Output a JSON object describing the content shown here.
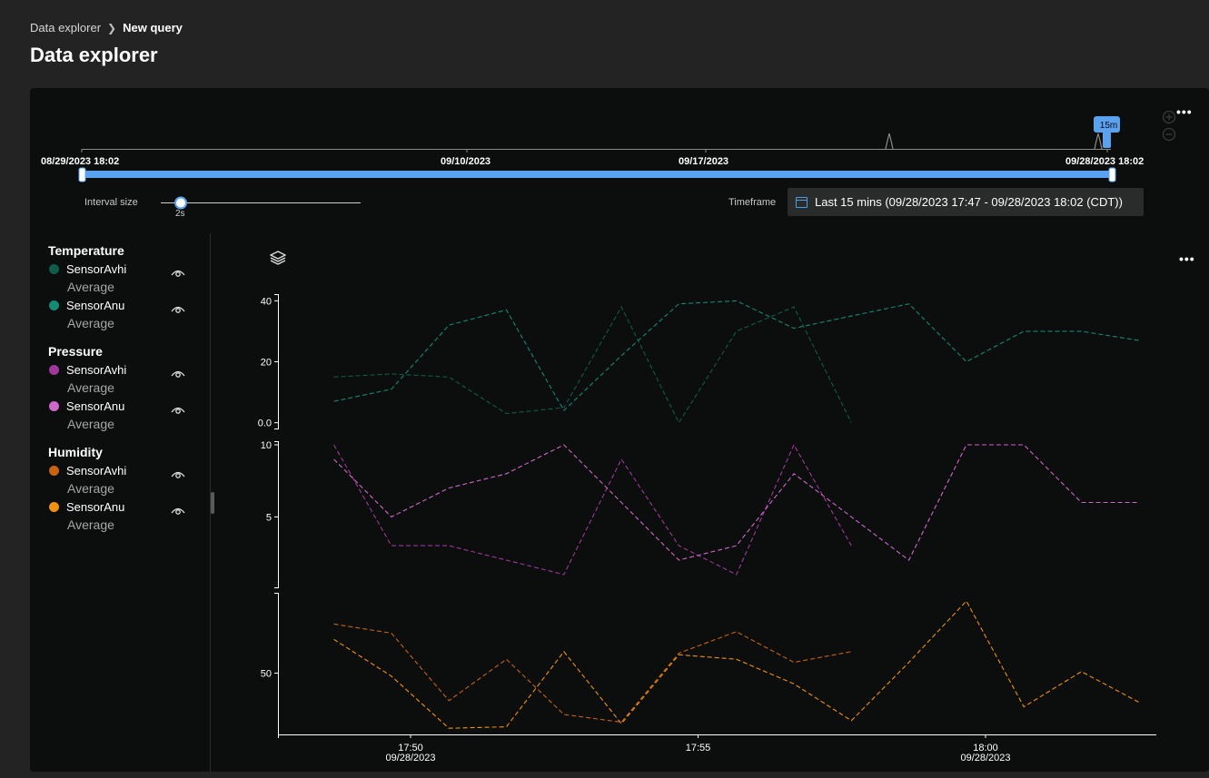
{
  "breadcrumb": {
    "parent": "Data explorer",
    "current": "New query"
  },
  "page_title": "Data explorer",
  "timeline": {
    "dates": [
      "08/29/2023 18:02",
      "09/10/2023",
      "09/17/2023",
      "09/28/2023 18:02"
    ],
    "window_badge": "15m"
  },
  "interval": {
    "label": "Interval size",
    "value": "2s"
  },
  "timeframe": {
    "label": "Timeframe",
    "value": "Last 15 mins (09/28/2023 17:47 - 09/28/2023 18:02 (CDT))"
  },
  "legend": [
    {
      "group": "Temperature",
      "items": [
        {
          "name": "SensorAvhi",
          "agg": "Average",
          "color": "#0e5c4a"
        },
        {
          "name": "SensorAnu",
          "agg": "Average",
          "color": "#128a74"
        }
      ]
    },
    {
      "group": "Pressure",
      "items": [
        {
          "name": "SensorAvhi",
          "agg": "Average",
          "color": "#a1379c"
        },
        {
          "name": "SensorAnu",
          "agg": "Average",
          "color": "#d067cc"
        }
      ]
    },
    {
      "group": "Humidity",
      "items": [
        {
          "name": "SensorAvhi",
          "agg": "Average",
          "color": "#c9630f"
        },
        {
          "name": "SensorAnu",
          "agg": "Average",
          "color": "#f0910f"
        }
      ]
    }
  ],
  "chart_data": {
    "type": "line",
    "x_ticks": [
      {
        "time": "17:50",
        "date": "09/28/2023"
      },
      {
        "time": "17:55",
        "date": ""
      },
      {
        "time": "18:00",
        "date": "09/28/2023"
      }
    ],
    "panels": [
      {
        "name": "Temperature",
        "y_ticks": [
          "40",
          "20",
          "0.0"
        ],
        "ylim": [
          -1,
          41
        ],
        "series": [
          {
            "name": "SensorAvhi",
            "color": "#0e5c4a",
            "x": [
              "17:48:40",
              "17:49:40",
              "17:50:40",
              "17:51:40",
              "17:52:40",
              "17:53:40",
              "17:54:40",
              "17:55:40",
              "17:56:40",
              "17:57:40"
            ],
            "values": [
              15,
              16,
              15,
              3,
              5,
              38,
              0,
              30,
              38,
              0
            ]
          },
          {
            "name": "SensorAnu",
            "color": "#128a74",
            "x": [
              "17:48:40",
              "17:49:40",
              "17:50:40",
              "17:51:40",
              "17:52:40",
              "17:53:40",
              "17:54:40",
              "17:55:40",
              "17:56:40",
              "17:57:40",
              "17:58:40",
              "17:59:40",
              "18:00:40",
              "18:01:40",
              "18:02:40"
            ],
            "values": [
              7,
              11,
              32,
              37,
              4,
              22,
              39,
              40,
              31,
              35,
              39,
              20,
              30,
              30,
              27
            ]
          }
        ]
      },
      {
        "name": "Pressure",
        "y_ticks": [
          "10",
          "5"
        ],
        "ylim": [
          0.3,
          10
        ],
        "series": [
          {
            "name": "SensorAvhi",
            "color": "#a1379c",
            "x": [
              "17:48:40",
              "17:49:40",
              "17:50:40",
              "17:51:40",
              "17:52:40",
              "17:53:40",
              "17:54:40",
              "17:55:40",
              "17:56:40",
              "17:57:40"
            ],
            "values": [
              10,
              3,
              3,
              2,
              1,
              9,
              3,
              1,
              10,
              3
            ]
          },
          {
            "name": "SensorAnu",
            "color": "#d067cc",
            "x": [
              "17:48:40",
              "17:49:40",
              "17:50:40",
              "17:51:40",
              "17:52:40",
              "17:53:40",
              "17:54:40",
              "17:55:40",
              "17:56:40",
              "17:57:40",
              "17:58:40",
              "17:59:40",
              "18:00:40",
              "18:01:40",
              "18:02:40"
            ],
            "values": [
              9,
              5,
              7,
              8,
              10,
              6,
              2,
              3,
              8,
              5,
              2,
              10,
              10,
              6,
              6
            ]
          }
        ]
      },
      {
        "name": "Humidity",
        "y_ticks": [
          "50"
        ],
        "ylim": [
          10,
          100
        ],
        "series": [
          {
            "name": "SensorAvhi",
            "color": "#c9630f",
            "x": [
              "17:48:40",
              "17:49:40",
              "17:50:40",
              "17:51:40",
              "17:52:40",
              "17:53:40",
              "17:54:40",
              "17:55:40",
              "17:56:40",
              "17:57:40"
            ],
            "values": [
              82,
              76,
              32,
              59,
              23,
              18,
              63,
              77,
              57,
              64
            ]
          },
          {
            "name": "SensorAnu",
            "color": "#f0910f",
            "x": [
              "17:48:40",
              "17:49:40",
              "17:50:40",
              "17:51:40",
              "17:52:40",
              "17:53:40",
              "17:54:40",
              "17:55:40",
              "17:56:40",
              "17:57:40",
              "17:58:40",
              "17:59:40",
              "18:00:40",
              "18:01:40",
              "18:02:40"
            ],
            "values": [
              72,
              48,
              14,
              15,
              64,
              17,
              62,
              59,
              43,
              19,
              57,
              97,
              28,
              51,
              31
            ]
          }
        ]
      }
    ]
  }
}
